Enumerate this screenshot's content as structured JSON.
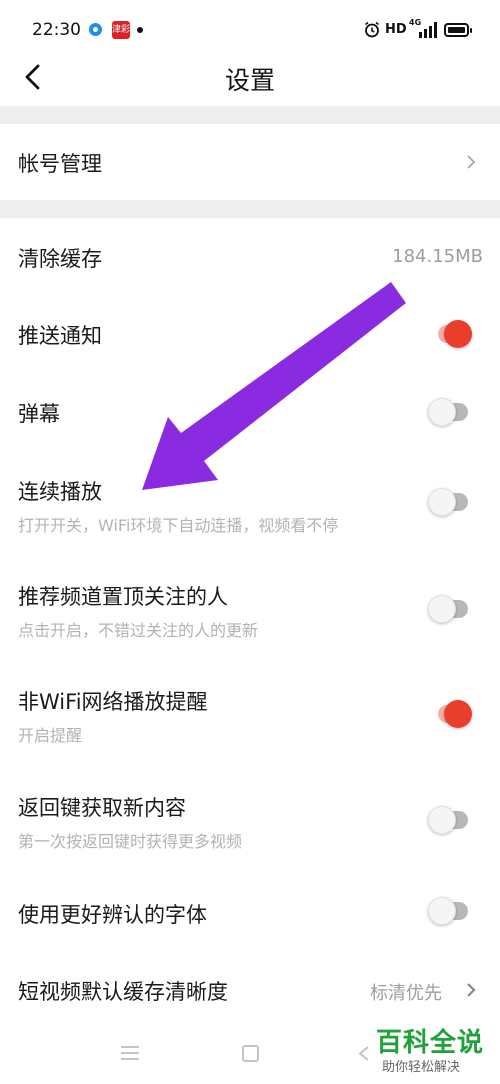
{
  "status_bar": {
    "time": "22:30",
    "app2_label": "津彩",
    "hd": "HD",
    "network": "4G",
    "icons": [
      "app-circle-icon",
      "app-red-icon",
      "notification-dot-icon",
      "alarm-icon",
      "signal-icon",
      "battery-icon"
    ]
  },
  "header": {
    "title": "设置",
    "back_icon": "chevron-left-icon"
  },
  "settings": {
    "account": {
      "label": "帐号管理"
    },
    "clear_cache": {
      "label": "清除缓存",
      "value": "184.15MB"
    },
    "push": {
      "label": "推送通知",
      "enabled": true
    },
    "danmaku": {
      "label": "弹幕",
      "enabled": false
    },
    "autoplay": {
      "label": "连续播放",
      "sub": "打开开关，WiFi环境下自动连播，视频看不停",
      "enabled": false
    },
    "pin_followed": {
      "label": "推荐频道置顶关注的人",
      "sub": "点击开启，不错过关注的人的更新",
      "enabled": false
    },
    "non_wifi": {
      "label": "非WiFi网络播放提醒",
      "sub": "开启提醒",
      "enabled": true
    },
    "back_refresh": {
      "label": "返回键获取新内容",
      "sub": "第一次按返回键时获得更多视频",
      "enabled": false
    },
    "readable_font": {
      "label": "使用更好辨认的字体",
      "enabled": false
    },
    "short_video_quality": {
      "label": "短视频默认缓存清晰度",
      "value": "标清优先"
    }
  },
  "colors": {
    "toggle_on": "#ea3e2c",
    "toggle_off": "#b8b8b8",
    "annotation_arrow": "#8a2be2",
    "watermark_green": "#1fa23a"
  },
  "nav_bar": {
    "icons": [
      "menu-icon",
      "home-square-icon",
      "back-triangle-icon"
    ]
  },
  "watermark": {
    "title": "百科全说",
    "subtitle": "助你轻松解决"
  }
}
